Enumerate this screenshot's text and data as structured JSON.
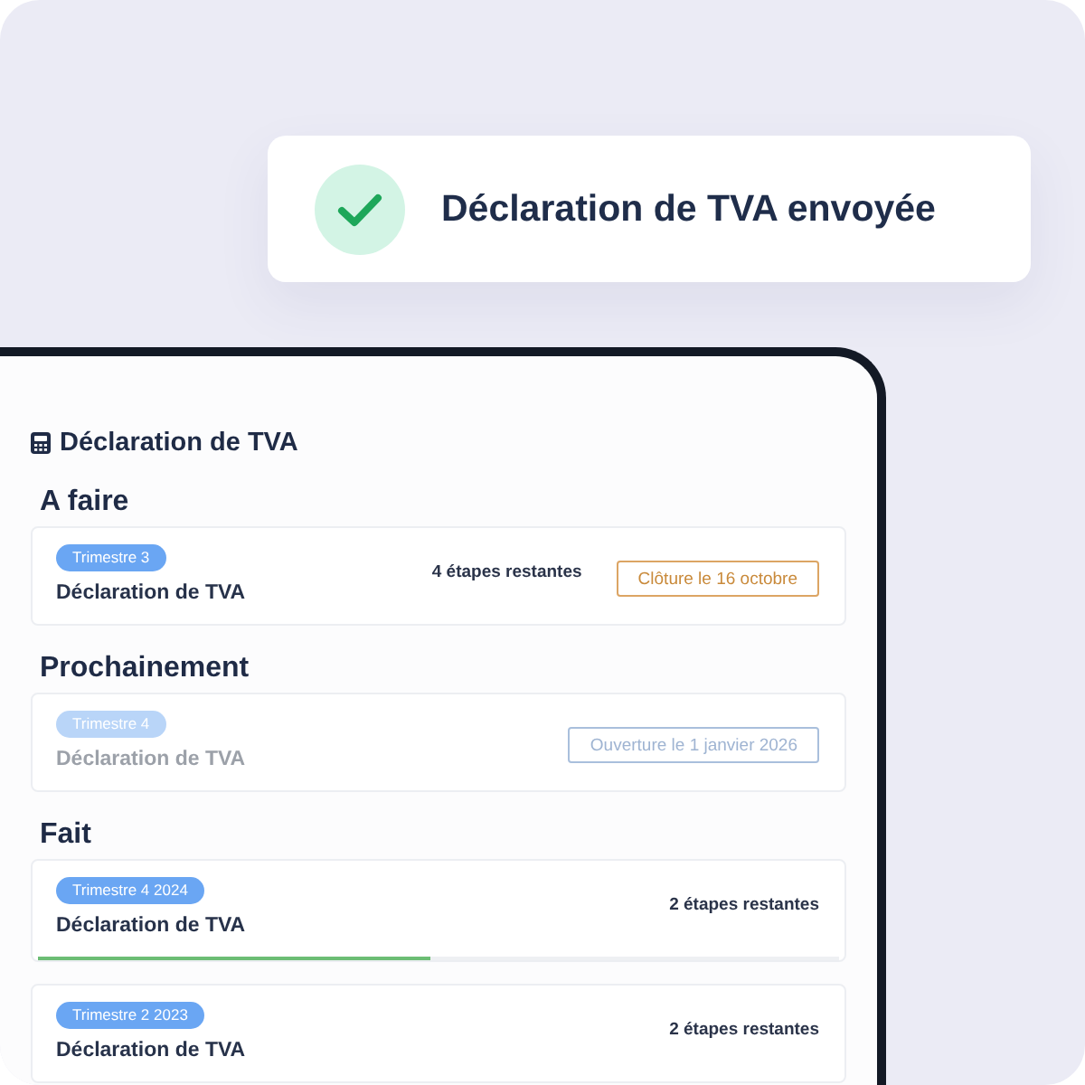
{
  "toast": {
    "message": "Déclaration de TVA envoyée"
  },
  "panel": {
    "title": "Déclaration de TVA",
    "sections": [
      {
        "heading": "A faire",
        "items": [
          {
            "badge": "Trimestre 3",
            "title": "Déclaration de TVA",
            "disabled": false,
            "steps": "4 étapes restantes",
            "action": "Clôture le 16 octobre"
          }
        ]
      },
      {
        "heading": "Prochainement",
        "items": [
          {
            "badge": "Trimestre 4",
            "title": "Déclaration de TVA",
            "disabled": true,
            "action": "Ouverture le 1 janvier 2026"
          }
        ]
      },
      {
        "heading": "Fait",
        "items": [
          {
            "badge": "Trimestre 4 2024",
            "title": "Déclaration de TVA",
            "disabled": false,
            "steps": "2 étapes restantes",
            "level": 0.49
          },
          {
            "badge": "Trimestre 2 2023",
            "title": "Déclaration de TVA",
            "disabled": false,
            "steps": "2 étapes restantes"
          }
        ]
      }
    ]
  }
}
